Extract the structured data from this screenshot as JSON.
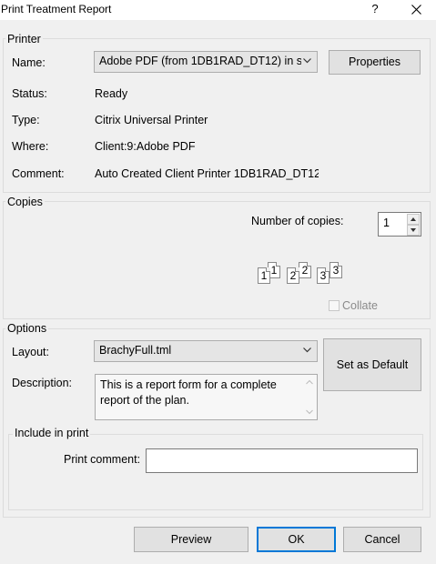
{
  "dialog": {
    "title": "Print Treatment Report",
    "help_glyph": "?"
  },
  "printer": {
    "group_label": "Printer",
    "name_label": "Name:",
    "name_value": "Adobe PDF (from 1DB1RAD_DT12) in s",
    "properties_button": "Properties",
    "status_label": "Status:",
    "status_value": "Ready",
    "type_label": "Type:",
    "type_value": "Citrix Universal Printer",
    "where_label": "Where:",
    "where_value": "Client:9:Adobe PDF",
    "comment_label": "Comment:",
    "comment_value": "Auto Created Client Printer 1DB1RAD_DT12"
  },
  "copies": {
    "group_label": "Copies",
    "number_label": "Number of copies:",
    "number_value": "1",
    "collate_label": "Collate",
    "collate_checked": false,
    "collate_pages": [
      [
        "1",
        "1"
      ],
      [
        "2",
        "2"
      ],
      [
        "3",
        "3"
      ]
    ]
  },
  "options": {
    "group_label": "Options",
    "layout_label": "Layout:",
    "layout_value": "BrachyFull.tml",
    "set_default_button": "Set as Default",
    "description_label": "Description:",
    "description_text": "This is a report form for a complete report of the plan.",
    "include_group_label": "Include in print",
    "print_comment_label": "Print comment:",
    "print_comment_value": ""
  },
  "footer": {
    "preview_button": "Preview",
    "ok_button": "OK",
    "cancel_button": "Cancel"
  },
  "icons": {
    "close": "close-icon",
    "dropdown": "chevron-down-icon",
    "spin_up": "spin-up-icon",
    "spin_down": "spin-down-icon"
  }
}
